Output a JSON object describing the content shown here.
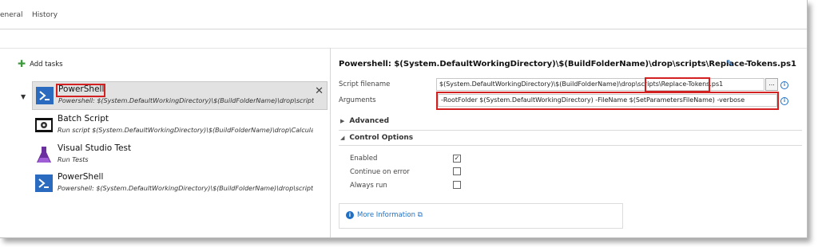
{
  "tabs": [
    "eneral",
    "History"
  ],
  "left": {
    "add_tasks": "Add tasks",
    "tasks": [
      {
        "name": "PowerShell",
        "sub": "Powershell: $(System.DefaultWorkingDirectory)\\$(BuildFolderName)\\drop\\scripts\\Replac"
      },
      {
        "name": "Batch Script",
        "sub": "Run script $(System.DefaultWorkingDirectory)\\$(BuildFolderName)\\drop\\CalculatorApp"
      },
      {
        "name": "Visual Studio Test",
        "sub": "Run Tests"
      },
      {
        "name": "PowerShell",
        "sub": "Powershell: $(System.DefaultWorkingDirectory)\\$(BuildFolderName)\\drop\\scripts\\Deplo"
      }
    ]
  },
  "right": {
    "title": "Powershell: $(System.DefaultWorkingDirectory)\\$(BuildFolderName)\\drop\\scripts\\Replace-Tokens.ps1",
    "script_label": "Script filename",
    "script_value": "$(System.DefaultWorkingDirectory)\\$(BuildFolderName)\\drop\\scripts\\",
    "script_value_highlight": "Replace-Tokens.ps1",
    "browse_label": "...",
    "args_label": "Arguments",
    "args_value": "-RootFolder $(System.DefaultWorkingDirectory) -FileName  $(SetParametersFileName) -verbose",
    "advanced": "Advanced",
    "control_options": "Control Options",
    "options": [
      {
        "label": "Enabled",
        "checked": true
      },
      {
        "label": "Continue on error",
        "checked": false
      },
      {
        "label": "Always run",
        "checked": false
      }
    ],
    "more_info": "More Information"
  },
  "colors": {
    "highlight": "#d32020",
    "accent": "#1f6fc5"
  }
}
